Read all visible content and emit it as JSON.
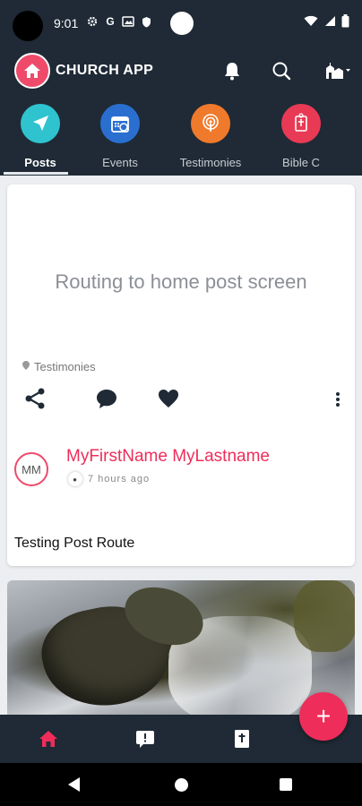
{
  "status_bar": {
    "time": "9:01",
    "icons": [
      "gear-icon",
      "google-icon",
      "gallery-icon",
      "shield-icon"
    ]
  },
  "app_bar": {
    "title": "CHURCH APP"
  },
  "tabs": [
    {
      "label": "Posts",
      "color": "#2fc3cf",
      "icon": "send-icon",
      "active": true
    },
    {
      "label": "Events",
      "color": "#2a6fd0",
      "icon": "calendar-icon",
      "active": false
    },
    {
      "label": "Testimonies",
      "color": "#f07a2b",
      "icon": "podcast-icon",
      "active": false
    },
    {
      "label": "Bible C",
      "color": "#e93a55",
      "icon": "bible-icon",
      "active": false
    }
  ],
  "post": {
    "routing_text": "Routing to home post screen",
    "category": "Testimonies",
    "avatar_initials": "MM",
    "author": "MyFirstName MyLastname",
    "time_ago": "7 hours ago",
    "text": "Testing Post Route"
  },
  "fab_label": "+",
  "colors": {
    "accent": "#ef2d5a",
    "bar": "#1f2a36",
    "feed_bg": "#eceef1"
  }
}
